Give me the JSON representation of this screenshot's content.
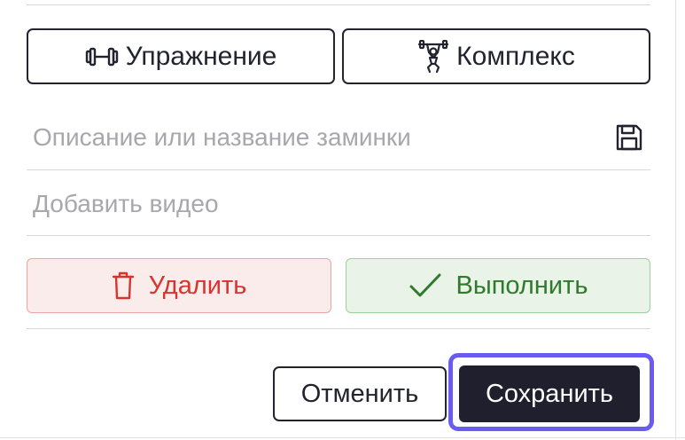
{
  "add_buttons": {
    "exercise_label": "Упражнение",
    "exercise_icon": "dumbbell-icon",
    "complex_label": "Комплекс",
    "complex_icon": "weightlifter-icon"
  },
  "fields": {
    "description_placeholder": "Описание или название заминки",
    "video_placeholder": "Добавить видео",
    "save_icon": "floppy-disk-icon"
  },
  "actions": {
    "delete_label": "Удалить",
    "delete_icon": "trash-icon",
    "complete_label": "Выполнить",
    "complete_icon": "checkmark-icon"
  },
  "footer": {
    "cancel_label": "Отменить",
    "save_label": "Сохранить"
  },
  "colors": {
    "primary_dark": "#1f1f2e",
    "focus_ring": "#6a5cf0",
    "danger_text": "#d8332c",
    "danger_bg": "#faeceb",
    "success_text": "#2f7a2c",
    "success_bg": "#e9f3e7",
    "placeholder": "#a7a7ad"
  }
}
